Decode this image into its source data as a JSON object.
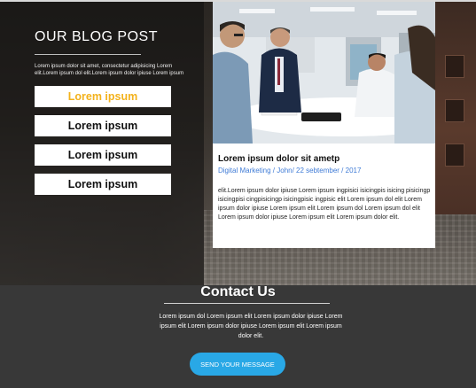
{
  "blog": {
    "title": "OUR BLOG POST",
    "description": "Lorem ipsum dolor sit amet, consectetur adipisicing Lorem elit.Lorem ipsum dol elit.Lorem ipsum dolor ipiuse Lorem ipsum",
    "menu": [
      {
        "label": "Lorem ipsum",
        "active": true
      },
      {
        "label": "Lorem ipsum",
        "active": false
      },
      {
        "label": "Lorem ipsum",
        "active": false
      },
      {
        "label": "Lorem ipsum",
        "active": false
      }
    ]
  },
  "post": {
    "title": "Lorem ipsum dolor sit ametp",
    "meta": "Digital Marketing / John/ 22 sebtember / 2017",
    "body": "elit.Lorem ipsum dolor ipiuse Lorem ipsum ingpisici isicingpis isicing pisicingp isicingpisi cingpisicingp isicingpisic ingpisic elit Lorem ipsum dol elit Lorem ipsum dolor ipiuse Lorem ipsum elit Lorem ipsum dol Lorem ipsum dol elit Lorem ipsum dolor ipiuse Lorem ipsum elit Lorem ipsum dolor elit."
  },
  "contact": {
    "title": "Contact Us",
    "description": "Lorem ipsum dol Lorem ipsum elit Lorem ipsum dolor ipiuse Lorem ipsum elit Lorem ipsum dolor ipiuse Lorem ipsum elit Lorem ipsum dolor elit.",
    "button_label": "SEND YOUR MESSAGE"
  },
  "colors": {
    "accent_active": "#f3b21c",
    "meta_link": "#3f7bd6",
    "button": "#29a8e6",
    "footer_bg": "#383838"
  },
  "icons": [
    "office-meeting-photo"
  ]
}
